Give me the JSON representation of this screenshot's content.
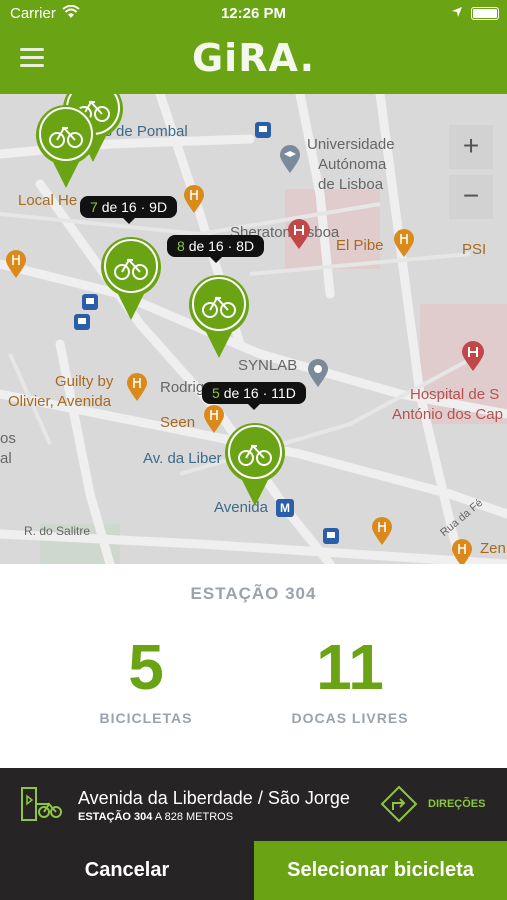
{
  "status_bar": {
    "carrier": "Carrier",
    "time": "12:26 PM"
  },
  "nav": {
    "logo": "GiRA."
  },
  "map": {
    "labels": {
      "marques_pombal": "es de Pombal",
      "universidade": "Universidade",
      "autonoma": "Autónoma",
      "de_lisboa": "de Lisboa",
      "local_he": "Local He",
      "sheraton": "Sheraton Lisboa",
      "el_pibe": "El Pibe",
      "psi": "PSI",
      "synlab": "SYNLAB",
      "guilty_by": "Guilty by",
      "olivier": "Olivier, Avenida",
      "rodrig": "Rodrig",
      "hospital_s": "Hospital de S",
      "antonio": "António dos Cap",
      "seen": "Seen",
      "av_liber": "Av. da Liber",
      "avenida": "Avenida",
      "metro": "M",
      "os": "os",
      "al": "al",
      "r_salitre": "R. do Salitre",
      "rua_fe": "Rua da Fé",
      "zen": "Zen"
    },
    "zoom_in": "+",
    "zoom_out": "−",
    "tooltips": [
      {
        "count": "7",
        "text": "de 16 · 9D"
      },
      {
        "count": "8",
        "text": "de 16 · 8D"
      },
      {
        "count": "5",
        "text": "de 16 · 11D"
      }
    ]
  },
  "station": {
    "title": "ESTAÇÃO 304",
    "bikes": "5",
    "bikes_label": "BICICLETAS",
    "docks": "11",
    "docks_label": "DOCAS LIVRES"
  },
  "info": {
    "address": "Avenida da Liberdade / São Jorge",
    "station_code": "ESTAÇÃO 304",
    "distance": "A 828 METROS",
    "directions": "DIREÇÕES"
  },
  "actions": {
    "cancel": "Cancelar",
    "select": "Selecionar bicicleta"
  },
  "colors": {
    "brand_green": "#6aa313",
    "dark": "#262424",
    "label_grey": "#9aa3ab"
  }
}
